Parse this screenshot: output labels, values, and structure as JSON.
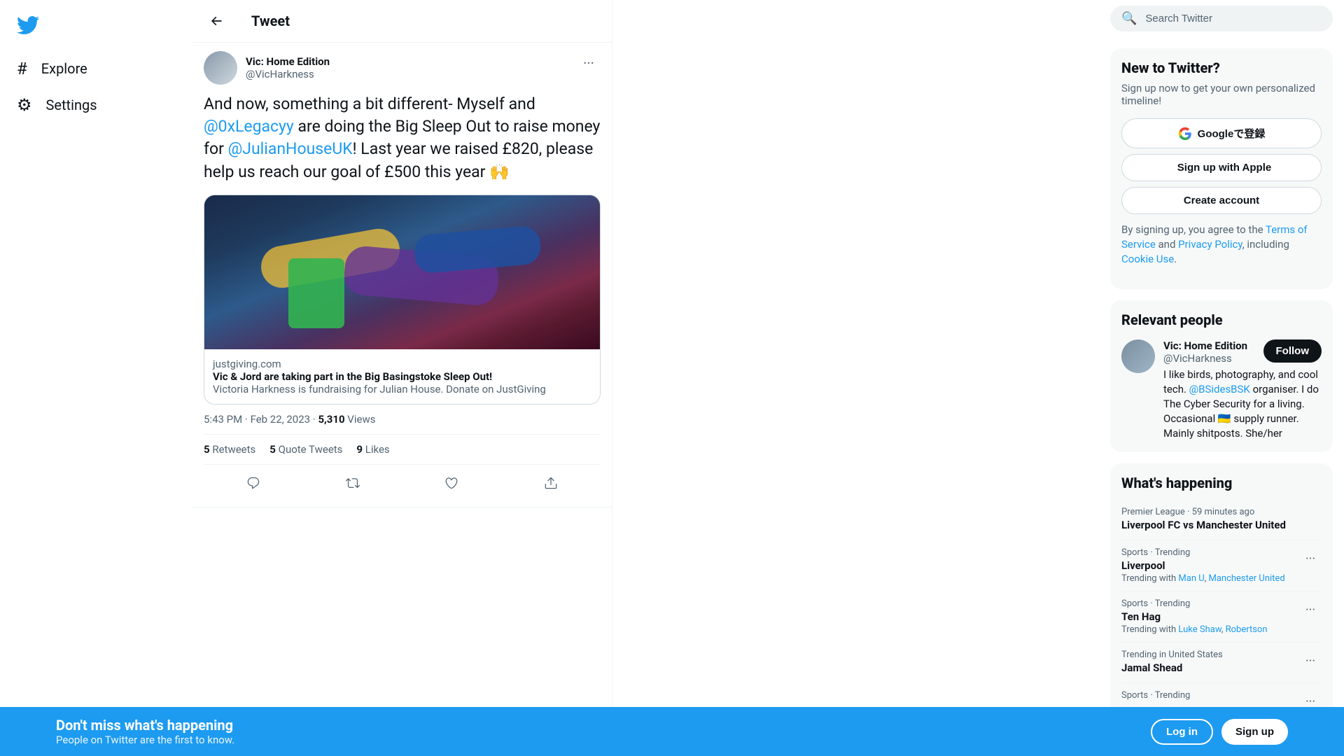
{
  "sidebar": {
    "logo_label": "Twitter",
    "nav_items": [
      {
        "id": "explore",
        "label": "Explore",
        "icon": "#"
      },
      {
        "id": "settings",
        "label": "Settings",
        "icon": "⚙"
      }
    ]
  },
  "tweet": {
    "back_label": "Tweet",
    "author": {
      "name": "Vic: Home Edition",
      "handle": "@VicHarkness",
      "avatar_alt": "Vic Home Edition avatar"
    },
    "text_parts": [
      {
        "type": "text",
        "content": "And now, something a bit different- Myself and "
      },
      {
        "type": "link",
        "content": "@0xLegacyy",
        "href": "#"
      },
      {
        "type": "text",
        "content": " are doing the Big Sleep Out to raise money for "
      },
      {
        "type": "link",
        "content": "@JulianHouseUK",
        "href": "#"
      },
      {
        "type": "text",
        "content": "!  Last year we raised £820, please help us reach our goal of £500 this year 🙌"
      }
    ],
    "link_preview": {
      "domain": "justgiving.com",
      "title": "Vic & Jord are taking part in the Big Basingstoke Sleep Out!",
      "description": "Victoria Harkness is fundraising for Julian House. Donate on JustGiving"
    },
    "timestamp": "5:43 PM · Feb 22, 2023",
    "views_count": "5,310",
    "views_label": "Views",
    "retweets_count": "5",
    "retweets_label": "Retweets",
    "quote_tweets_count": "5",
    "quote_tweets_label": "Quote Tweets",
    "likes_count": "9",
    "likes_label": "Likes",
    "actions": {
      "reply_label": "Reply",
      "retweet_label": "Retweet",
      "like_label": "Like",
      "share_label": "Share"
    }
  },
  "right_sidebar": {
    "search": {
      "placeholder": "Search Twitter"
    },
    "new_to_twitter": {
      "title": "New to Twitter?",
      "subtitle": "Sign up now to get your own personalized timeline!",
      "google_btn": "Googleで登録",
      "apple_btn": "Sign up with Apple",
      "create_account_btn": "Create account",
      "terms_text": "By signing up, you agree to the ",
      "terms_link": "Terms of Service",
      "terms_and": " and ",
      "privacy_link": "Privacy Policy",
      "terms_rest": ", including ",
      "cookie_link": "Cookie Use",
      "terms_end": "."
    },
    "relevant_people": {
      "title": "Relevant people",
      "people": [
        {
          "name": "Vic: Home Edition",
          "handle": "@VicHarkness",
          "bio_parts": [
            {
              "type": "text",
              "content": "I like birds, photography, and cool tech. "
            },
            {
              "type": "link",
              "content": "@BSidesBSK",
              "href": "#"
            },
            {
              "type": "text",
              "content": " organiser. I do The Cyber Security for a living. Occasional 🇺🇦 supply runner. Mainly shitposts. She/her"
            }
          ],
          "follow_label": "Follow"
        }
      ]
    },
    "whats_happening": {
      "title": "What's happening",
      "trends": [
        {
          "meta": "Premier League · 59 minutes ago",
          "name": "Liverpool FC vs Manchester United",
          "desc": ""
        },
        {
          "meta": "Sports · Trending",
          "name": "Liverpool",
          "desc_prefix": "Trending with ",
          "desc_links": [
            "Man U",
            "Manchester United"
          ]
        },
        {
          "meta": "Sports · Trending",
          "name": "Ten Hag",
          "desc_prefix": "Trending with ",
          "desc_links": [
            "Luke Shaw",
            "Robertson"
          ]
        },
        {
          "meta": "Trending in United States",
          "name": "Jamal Shead",
          "desc": ""
        },
        {
          "meta": "Sports · Trending",
          "name": "",
          "desc": ""
        }
      ]
    }
  },
  "bottom_banner": {
    "primary_text": "Don't miss what's happening",
    "secondary_text": "People on Twitter are the first to know.",
    "login_label": "Log in",
    "signup_label": "Sign up"
  }
}
